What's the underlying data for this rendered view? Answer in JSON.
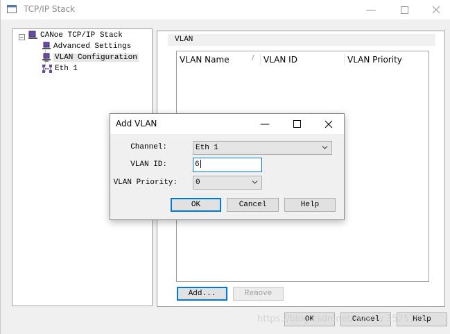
{
  "window": {
    "title": "TCP/IP Stack"
  },
  "tree": {
    "root": "CANoe TCP/IP Stack",
    "items": [
      "Advanced Settings",
      "VLAN Configuration",
      "Eth 1"
    ],
    "expander": "−"
  },
  "vlan_group": {
    "title": "VLAN",
    "columns": [
      "VLAN Name",
      "VLAN ID",
      "VLAN Priority"
    ],
    "sort_glyph": "/",
    "add_button": "Add...",
    "remove_button": "Remove"
  },
  "footer": {
    "ok": "OK",
    "cancel": "Cancel",
    "help": "Help"
  },
  "dialog": {
    "title": "Add VLAN",
    "channel_label": "Channel:",
    "channel_value": "Eth 1",
    "vlan_id_label": "VLAN ID:",
    "vlan_id_value": "6",
    "priority_label": "VLAN Priority:",
    "priority_value": "0",
    "ok": "OK",
    "cancel": "Cancel",
    "help": "Help"
  },
  "watermark": "https://blog.csdn.net/wzw_u  3525195",
  "colors": {
    "focus_blue": "#0078d7",
    "tree_icon": "#6a4aa5"
  }
}
